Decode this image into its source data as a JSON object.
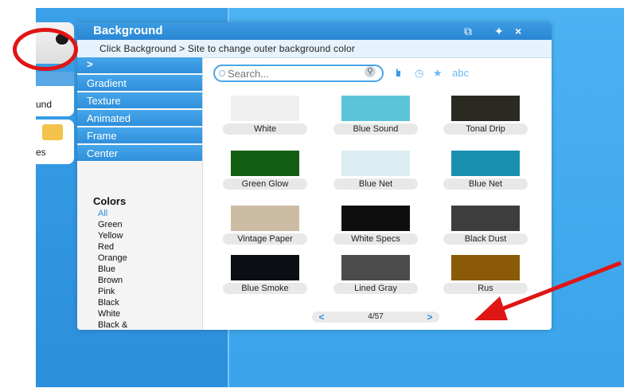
{
  "panel": {
    "title": "Background",
    "instruction": "Click Background > Site to change outer background color",
    "icons": {
      "restore": "window-icon",
      "pin": "pin-icon",
      "close": "×"
    }
  },
  "side_tiles": [
    {
      "label": "",
      "icon": "film-reel-icon"
    },
    {
      "label": "und",
      "icon": ""
    },
    {
      "label": "es",
      "icon": "folder-icon"
    }
  ],
  "categories": [
    {
      "label": "",
      "arrow": ">"
    },
    {
      "label": "Gradient"
    },
    {
      "label": "Texture"
    },
    {
      "label": "Animated"
    },
    {
      "label": "Frame"
    },
    {
      "label": "Center"
    }
  ],
  "colors": {
    "heading": "Colors",
    "items": [
      "All",
      "Green",
      "Yellow",
      "Red",
      "Orange",
      "Blue",
      "Brown",
      "Pink",
      "Black",
      "White",
      "Black &"
    ],
    "selected": "All"
  },
  "search": {
    "placeholder": "Search..."
  },
  "sort_options": [
    {
      "icon": "bar-chart-icon",
      "text": "lıı"
    },
    {
      "icon": "clock-icon",
      "text": "◷"
    },
    {
      "icon": "star-icon",
      "text": "★"
    },
    {
      "icon": "abc-text",
      "text": "abc"
    }
  ],
  "grid": [
    {
      "caption": "White",
      "color": "#f0f0f0"
    },
    {
      "caption": "Blue Sound",
      "color": "#5cc4d8"
    },
    {
      "caption": "Tonal Drip",
      "color": "#2a2a22"
    },
    {
      "caption": "Green Glow",
      "color": "#135e12"
    },
    {
      "caption": "Blue Net",
      "color": "#dcecf3"
    },
    {
      "caption": "Blue Net",
      "color": "#1a8fb0"
    },
    {
      "caption": "Vintage Paper",
      "color": "#cdbca4"
    },
    {
      "caption": "White Specs",
      "color": "#0e0e0e"
    },
    {
      "caption": "Black Dust",
      "color": "#3d3d3d"
    },
    {
      "caption": "Blue Smoke",
      "color": "#0b0f14"
    },
    {
      "caption": "Lined Gray",
      "color": "#4c4c4c"
    },
    {
      "caption": "Rus",
      "color": "#8a5a08"
    }
  ],
  "pager": {
    "prev": "<",
    "next": ">",
    "page": "4/57"
  },
  "annotation_colors": {
    "circle": "#e01515",
    "arrow": "#e01515"
  }
}
